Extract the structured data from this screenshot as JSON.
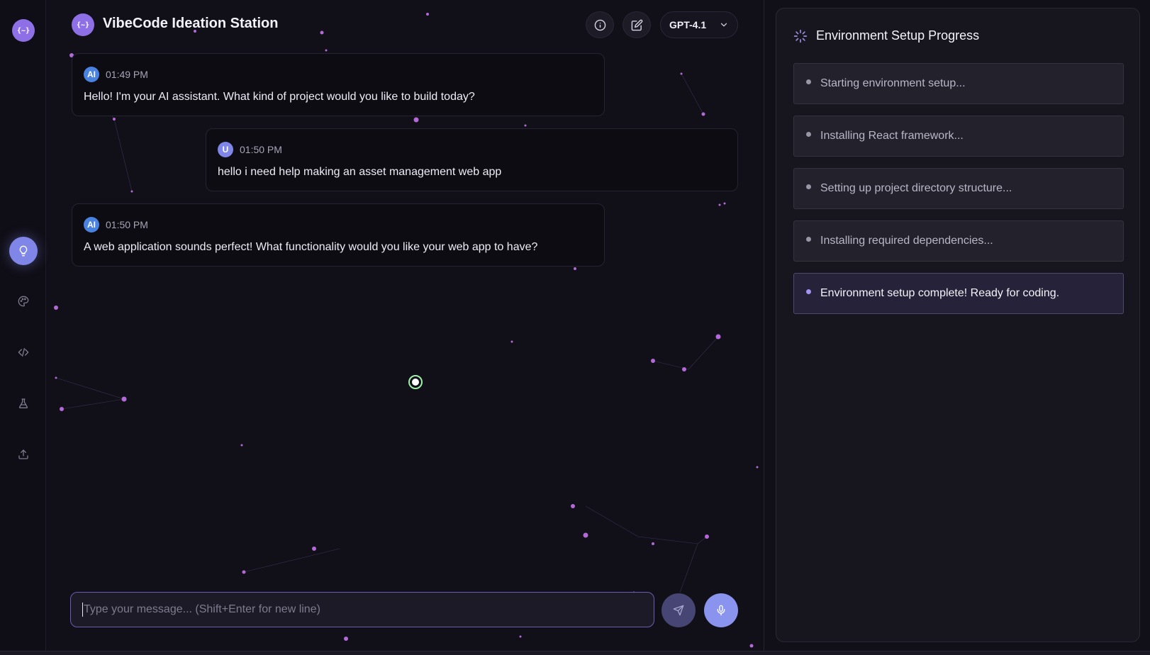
{
  "app": {
    "logo_text": "{~}",
    "title": "VibeCode Ideation Station"
  },
  "header": {
    "info_icon": "info-icon",
    "edit_icon": "edit-icon",
    "model_select": {
      "value": "GPT-4.1"
    }
  },
  "sidebar": {
    "items": [
      {
        "icon": "lightbulb-icon",
        "active": true
      },
      {
        "icon": "palette-icon",
        "active": false
      },
      {
        "icon": "code-icon",
        "active": false
      },
      {
        "icon": "flask-icon",
        "active": false
      },
      {
        "icon": "upload-icon",
        "active": false
      }
    ]
  },
  "messages": [
    {
      "role": "ai",
      "avatar": "AI",
      "time": "01:49 PM",
      "text": "Hello! I'm your AI assistant. What kind of project would you like to build today?"
    },
    {
      "role": "user",
      "avatar": "U",
      "time": "01:50 PM",
      "text": "hello i need help making an asset management web app"
    },
    {
      "role": "ai",
      "avatar": "AI",
      "time": "01:50 PM",
      "text": "A web application sounds perfect! What functionality would you like your web app to have?"
    }
  ],
  "composer": {
    "placeholder": "Type your message... (Shift+Enter for new line)",
    "value": ""
  },
  "setup_panel": {
    "title": "Environment Setup Progress",
    "steps": [
      {
        "label": "Starting environment setup...",
        "state": "pending"
      },
      {
        "label": "Installing React framework...",
        "state": "pending"
      },
      {
        "label": "Setting up project directory structure...",
        "state": "pending"
      },
      {
        "label": "Installing required dependencies...",
        "state": "pending"
      },
      {
        "label": "Environment setup complete! Ready for coding.",
        "state": "complete"
      }
    ]
  },
  "colors": {
    "accent": "#8f6fe6",
    "active_nav": "#7f86e8",
    "background": "#111019",
    "panel": "#17161f"
  }
}
